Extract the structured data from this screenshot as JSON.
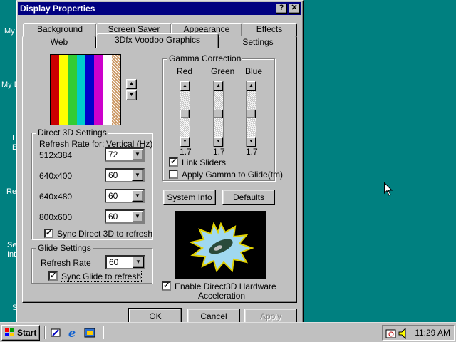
{
  "window": {
    "title": "Display Properties",
    "help_label": "?",
    "close_label": "✕"
  },
  "tabs": {
    "row1": [
      "Background",
      "Screen Saver",
      "Appearance",
      "Effects"
    ],
    "row2": [
      "Web",
      "3Dfx Voodoo Graphics",
      "Settings"
    ],
    "active": "3Dfx Voodoo Graphics"
  },
  "color_bars": [
    "#cc0000",
    "#ffff00",
    "#33cc33",
    "#00cccc",
    "#0000cc",
    "#cc00cc",
    "#ffffff",
    "#cc9966"
  ],
  "spinner": {
    "up": "▲",
    "down": "▼"
  },
  "direct3d": {
    "title": "Direct 3D Settings",
    "refresh_rate_for": "Refresh Rate for:",
    "vertical": "Vertical (Hz)",
    "rows": [
      {
        "res": "512x384",
        "value": "72"
      },
      {
        "res": "640x400",
        "value": "60"
      },
      {
        "res": "640x480",
        "value": "60"
      },
      {
        "res": "800x600",
        "value": "60"
      }
    ],
    "sync_label": "Sync Direct 3D to refresh",
    "sync_checked": true
  },
  "glide": {
    "title": "Glide Settings",
    "refresh_label": "Refresh Rate",
    "refresh_value": "60",
    "sync_label": "Sync Glide to refresh",
    "sync_checked": true
  },
  "gamma": {
    "title": "Gamma Correction",
    "channels": [
      {
        "name": "Red",
        "value": "1.7",
        "level": 0.5
      },
      {
        "name": "Green",
        "value": "1.7",
        "level": 0.5
      },
      {
        "name": "Blue",
        "value": "1.7",
        "level": 0.5
      }
    ],
    "link_label": "Link Sliders",
    "link_checked": true,
    "apply_glide_label": "Apply Gamma to Glide(tm)",
    "apply_glide_checked": false
  },
  "buttons": {
    "system_info": "System Info",
    "defaults": "Defaults",
    "ok": "OK",
    "cancel": "Cancel",
    "apply": "Apply"
  },
  "enable_d3d": {
    "label_line1": "Enable Direct3D Hardware",
    "label_line2": "Acceleration",
    "checked": true
  },
  "check_mark": "✓",
  "desktop_fragments": [
    "My",
    "My D",
    "I",
    "E",
    "Re",
    "Se",
    "Int",
    "S"
  ],
  "taskbar": {
    "start_label": "Start",
    "quick_launch": [
      "show-desktop-icon",
      "internet-explorer-icon",
      "channels-icon"
    ],
    "clock": "11:29 AM"
  }
}
